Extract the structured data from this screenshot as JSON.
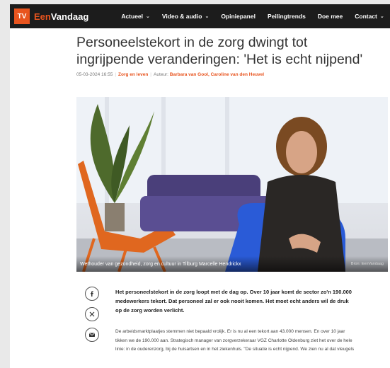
{
  "navbar": {
    "logo_badge": "TV",
    "logo_prefix": "Een",
    "logo_suffix": "Vandaag",
    "items": [
      {
        "label": "Actueel",
        "dropdown": true
      },
      {
        "label": "Video & audio",
        "dropdown": true
      },
      {
        "label": "Opiniepanel",
        "dropdown": false
      },
      {
        "label": "Peilingtrends",
        "dropdown": false
      },
      {
        "label": "Doe mee",
        "dropdown": false
      },
      {
        "label": "Contact",
        "dropdown": true
      }
    ],
    "search_icon": "microphone-icon"
  },
  "article": {
    "title": "Personeelstekort in de zorg dwingt tot ingrijpende veranderingen: 'Het is echt nijpend'",
    "date": "05-03-2024 16:55",
    "category": "Zorg en leven",
    "author_label": "Auteur:",
    "authors": "Barbara van Gool, Caroline van den Heuvel",
    "image_caption": "Wethouder van gezondheid, zorg en cultuur in Tilburg Marcelle Hendrickx",
    "image_credit": "Bron: EenVandaag",
    "intro": "Het personeelstekort in de zorg loopt met de dag op. Over 10 jaar komt de sector zo'n 190.000 medewerkers tekort. Dat personeel zal er ook nooit komen. Het moet echt anders wil de druk op de zorg worden verlicht.",
    "body": "De arbeidsmarktplaatjes stemmen niet bepaald vrolijk. Er is nu al een tekort aan 43.000 mensen. En over 10 jaar tikken we de 190.000 aan. Strategisch manager van zorgverzekeraar VGZ Charlotte Oldenburg ziet het over de hele linie: in de ouderenzorg, bij de huisartsen en in het ziekenhuis. \"De situatie is echt nijpend. We zien nu al dat vleugels"
  },
  "share": [
    "facebook-icon",
    "x-icon",
    "email-icon"
  ],
  "colors": {
    "accent": "#e8541e",
    "navbar": "#1c1c1c"
  }
}
